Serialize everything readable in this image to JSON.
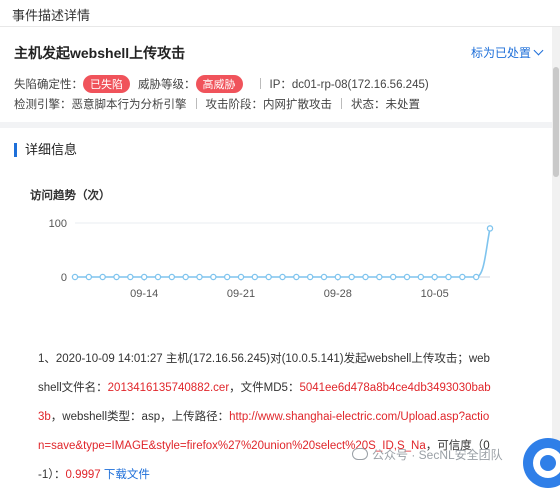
{
  "window": {
    "title": "事件描述详情"
  },
  "event": {
    "title": "主机发起webshell上传攻击",
    "mark_button": "标为已处置",
    "row1": {
      "confirm_label": "失陷确定性：",
      "confirm_badge": "已失陷",
      "threat_label": "威胁等级：",
      "threat_badge": "高威胁",
      "ip_label": "IP：",
      "ip_value": "dc01-rp-08(172.16.56.245)"
    },
    "row2": {
      "engine_label": "检测引擎：",
      "engine_value": "恶意脚本行为分析引擎",
      "stage_label": "攻击阶段：",
      "stage_value": "内网扩散攻击",
      "status_label": "状态：",
      "status_value": "未处置"
    }
  },
  "section": {
    "title": "详细信息"
  },
  "chart_data": {
    "type": "line",
    "title": "访问趋势（次）",
    "y_ticks": [
      "100",
      "0"
    ],
    "x_ticks": [
      "09-14",
      "09-21",
      "09-28",
      "10-05"
    ],
    "ylim": [
      0,
      100
    ],
    "x": [
      "09-09",
      "09-10",
      "09-11",
      "09-12",
      "09-13",
      "09-14",
      "09-15",
      "09-16",
      "09-17",
      "09-18",
      "09-19",
      "09-20",
      "09-21",
      "09-22",
      "09-23",
      "09-24",
      "09-25",
      "09-26",
      "09-27",
      "09-28",
      "09-29",
      "09-30",
      "10-01",
      "10-02",
      "10-03",
      "10-04",
      "10-05",
      "10-06",
      "10-07",
      "10-08",
      "10-09"
    ],
    "values": [
      0,
      0,
      0,
      0,
      0,
      0,
      0,
      0,
      0,
      0,
      0,
      0,
      0,
      0,
      0,
      0,
      0,
      0,
      0,
      0,
      0,
      0,
      0,
      0,
      0,
      0,
      0,
      0,
      0,
      0,
      90
    ],
    "color": "#7fc4ee"
  },
  "details": {
    "p1": "1、2020-10-09 14:01:27 主机(172.16.56.245)对(10.0.5.141)发起webshell上传攻击；webshell文件名：",
    "filename": "2013416135740882.cer",
    "p2": "，文件MD5：",
    "md5": "5041ee6d478a8b4ce4db3493030bab3b",
    "p3": "，webshell类型：asp，上传路径：",
    "path": "http://www.shanghai-electric.com/Upload.asp?action=save&type=IMAGE&style=firefox%27%20union%20select%20S_ID,S_Na",
    "p4": "，可信度（0-1）：",
    "confidence": "0.9997",
    "download": "下载文件"
  },
  "watermark": {
    "text": "公众号 · SecNL安全团队"
  },
  "colors": {
    "accent": "#1e6fd9",
    "danger": "#f0535b",
    "line": "#7fc4ee"
  }
}
